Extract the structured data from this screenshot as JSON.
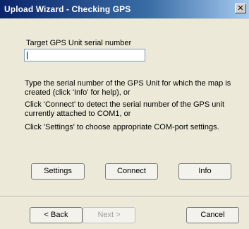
{
  "window": {
    "title": "Upload Wizard - Checking GPS",
    "close_glyph": "✕"
  },
  "form": {
    "serial_label": "Target GPS Unit serial number",
    "serial_value": "",
    "help_text_1": "Type the serial number of the GPS Unit for which the map is created (click 'Info' for help), or",
    "help_text_2": "Click 'Connect' to detect the serial number of the GPS unit currently attached to COM1, or",
    "help_text_3": "Click 'Settings' to choose appropriate COM-port settings."
  },
  "actions": {
    "settings": "Settings",
    "connect": "Connect",
    "info": "Info"
  },
  "navigation": {
    "back": "< Back",
    "next": "Next >",
    "cancel": "Cancel"
  },
  "colors": {
    "title_gradient_start": "#0a246a",
    "title_gradient_end": "#a6caf0",
    "dialog_bg": "#ece9d8"
  }
}
